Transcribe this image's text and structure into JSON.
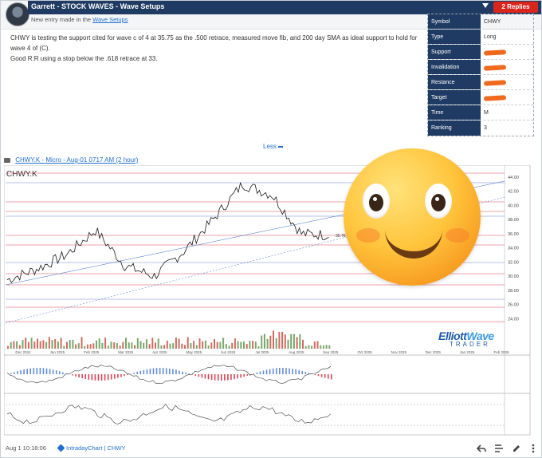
{
  "post": {
    "author_line": "Garrett - STOCK WAVES - Wave Setups",
    "replies_label": "2 Replies",
    "sub_prefix": "New entry made in the",
    "sub_link": "Wave Setups",
    "body_line1": "CHWY is testing the support cited for wave c of 4 at 35.75 as the .500 retrace, measured move fib, and 200 day SMA as ideal support to hold for wave 4 of (C).",
    "body_line2": "Good R:R using a stop below the .618 retrace at 33.",
    "less_label": "Less"
  },
  "info_table": [
    {
      "key": "Symbol",
      "value": "CHWY"
    },
    {
      "key": "Type",
      "value": "Long"
    },
    {
      "key": "Support",
      "value": ""
    },
    {
      "key": "Invalidation",
      "value": ""
    },
    {
      "key": "Restance",
      "value": ""
    },
    {
      "key": "Target",
      "value": ""
    },
    {
      "key": "Time",
      "value": "M"
    },
    {
      "key": "Ranking",
      "value": "3"
    }
  ],
  "chart_header": {
    "link_text": "CHWY.K - Micro - Aug-01 0717 AM (2 hour)",
    "symbol": "CHWY.K"
  },
  "footer": {
    "timestamp": "Aug 1 10:18:06",
    "tag_text": "IntradayChart | CHWY"
  },
  "logo": {
    "line1a": "Elliott",
    "line1b": "Wave",
    "line2": "TRADER"
  },
  "chart_data": {
    "type": "line",
    "symbol": "CHWY.K",
    "x": [
      "Dec 2024",
      "Jan 2025",
      "Feb 2025",
      "Mar 2025",
      "Apr 2025",
      "May 2025",
      "Jun 2025",
      "Jul 2025",
      "Aug 2025",
      "Sep 2025",
      "Oct 2025",
      "Nov 2025",
      "Dec 2025",
      "Jan 2026",
      "Feb 2026"
    ],
    "series": [
      {
        "values": [
          29.5,
          31.0,
          33.0,
          36.5,
          31.5,
          30.0,
          33.5,
          38.0,
          43.0,
          41.5,
          36.0,
          35.8
        ]
      }
    ],
    "y_ticks": [
      24,
      26,
      28,
      30,
      32,
      34,
      36,
      38,
      40,
      42,
      44
    ],
    "ylim": [
      20,
      45
    ],
    "annotations": [
      "35.76",
      ".500",
      ".618",
      "33"
    ],
    "colors": {
      "price": "#1a1a1a",
      "fib_line": "#d2182a",
      "channel": "#3a6fd1",
      "emoji": "#ffc53d",
      "accent": "#f06a1e"
    }
  }
}
